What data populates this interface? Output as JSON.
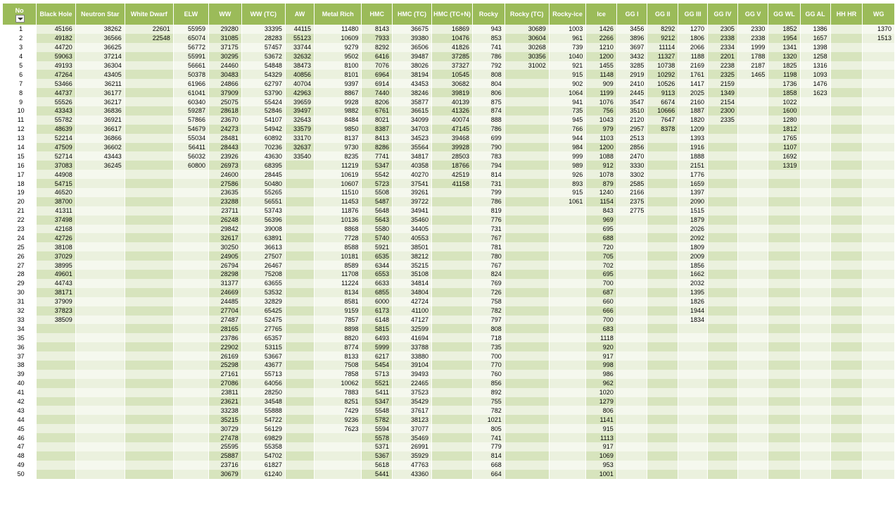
{
  "columns": [
    "Black Hole",
    "Neutron Star",
    "White Dwarf",
    "ELW",
    "WW",
    "WW (TC)",
    "AW",
    "Metal Rich",
    "HMC",
    "HMC (TC)",
    "HMC (TC+N)",
    "Rocky",
    "Rocky (TC)",
    "Rocky-ice",
    "Ice",
    "GG I",
    "GG II",
    "GG III",
    "GG IV",
    "GG V",
    "GG WL",
    "GG AL",
    "HH HR",
    "WG"
  ],
  "no_header": "No",
  "data": {
    "Black Hole": [
      "45166",
      "49182",
      "44720",
      "59063",
      "49193",
      "47264",
      "53466",
      "44737",
      "55526",
      "43343",
      "55782",
      "48639",
      "52214",
      "47509",
      "52714",
      "37083",
      "44908",
      "54715",
      "46520",
      "38700",
      "41311",
      "37498",
      "42168",
      "42726",
      "38108",
      "37029",
      "38995",
      "49601",
      "44743",
      "38171",
      "37909",
      "37823",
      "38509"
    ],
    "Neutron Star": [
      "38262",
      "36566",
      "36625",
      "37214",
      "36304",
      "43405",
      "36211",
      "36177",
      "36217",
      "36836",
      "36921",
      "36617",
      "36866",
      "36602",
      "43443",
      "36245"
    ],
    "White Dwarf": [
      "22601",
      "22548"
    ],
    "ELW": [
      "55959",
      "65074",
      "56772",
      "55991",
      "56661",
      "50378",
      "61966",
      "61041",
      "60340",
      "59287",
      "57866",
      "54679",
      "55034",
      "56411",
      "56032",
      "60800"
    ],
    "WW": [
      "29280",
      "31085",
      "37175",
      "30295",
      "24460",
      "30483",
      "24866",
      "37909",
      "25075",
      "28618",
      "23670",
      "24273",
      "28481",
      "28443",
      "23926",
      "26973",
      "24600",
      "27586",
      "23635",
      "23288",
      "23711",
      "26248",
      "29842",
      "32617",
      "30250",
      "24905",
      "26794",
      "28298",
      "31377",
      "24669",
      "24485",
      "27704",
      "27487",
      "28165",
      "23786",
      "22902",
      "26169",
      "25298",
      "27161",
      "27086",
      "23811",
      "23621",
      "33238",
      "35215",
      "30729",
      "27478",
      "25595",
      "25887",
      "23716",
      "30679"
    ],
    "WW (TC)": [
      "33395",
      "28283",
      "57457",
      "53672",
      "54848",
      "54329",
      "62797",
      "53790",
      "55424",
      "52846",
      "54107",
      "54942",
      "60892",
      "70236",
      "43630",
      "68395",
      "28445",
      "50480",
      "55265",
      "56551",
      "53743",
      "56396",
      "39008",
      "63891",
      "36613",
      "27507",
      "26467",
      "75208",
      "63655",
      "53532",
      "32829",
      "65425",
      "52475",
      "27765",
      "65357",
      "53115",
      "53667",
      "43677",
      "55713",
      "64056",
      "28250",
      "34548",
      "55888",
      "54722",
      "56129",
      "69829",
      "55358",
      "54702",
      "61827",
      "61240"
    ],
    "AW": [
      "44115",
      "55123",
      "33744",
      "32632",
      "38473",
      "40856",
      "40704",
      "42963",
      "39659",
      "39497",
      "32643",
      "33579",
      "33170",
      "32637",
      "33540"
    ],
    "Metal Rich": [
      "11480",
      "10609",
      "9279",
      "9502",
      "8100",
      "8101",
      "9397",
      "8867",
      "9928",
      "9882",
      "8484",
      "9850",
      "8137",
      "9730",
      "8235",
      "11219",
      "10619",
      "10607",
      "11510",
      "11453",
      "11876",
      "10136",
      "8868",
      "7728",
      "8588",
      "10181",
      "8589",
      "11708",
      "11224",
      "8134",
      "8581",
      "9159",
      "7857",
      "8898",
      "8820",
      "8774",
      "8133",
      "7508",
      "7858",
      "10062",
      "7883",
      "8251",
      "7429",
      "9236",
      "7623"
    ],
    "HMC": [
      "8143",
      "7933",
      "8292",
      "6416",
      "7076",
      "6964",
      "6914",
      "7440",
      "8206",
      "6761",
      "8021",
      "8387",
      "8413",
      "8286",
      "7741",
      "5347",
      "5542",
      "5723",
      "5508",
      "5487",
      "5648",
      "5643",
      "5580",
      "5740",
      "5921",
      "6535",
      "6344",
      "6553",
      "6633",
      "6855",
      "6000",
      "6173",
      "6148",
      "5815",
      "6493",
      "5999",
      "6217",
      "5454",
      "5713",
      "5521",
      "5411",
      "5347",
      "5548",
      "5782",
      "5594",
      "5578",
      "5371",
      "5367",
      "5618",
      "5441"
    ],
    "HMC (TC)": [
      "36675",
      "39380",
      "36506",
      "39487",
      "38026",
      "38194",
      "43453",
      "38246",
      "35877",
      "36615",
      "34099",
      "34703",
      "34523",
      "35564",
      "34817",
      "40358",
      "40270",
      "37541",
      "39261",
      "39722",
      "34941",
      "35460",
      "34405",
      "40553",
      "38501",
      "38212",
      "35215",
      "35108",
      "34814",
      "34804",
      "42724",
      "41100",
      "47127",
      "32599",
      "41694",
      "33788",
      "33880",
      "39104",
      "39493",
      "22465",
      "37523",
      "35429",
      "37617",
      "38123",
      "37077",
      "35469",
      "26991",
      "35929",
      "47763",
      "43360"
    ],
    "HMC (TC+N)": [
      "16869",
      "10476",
      "41826",
      "37285",
      "37327",
      "10545",
      "30682",
      "39819",
      "40139",
      "41326",
      "40074",
      "47145",
      "39468",
      "39928",
      "28503",
      "18766",
      "42519",
      "41158"
    ],
    "Rocky": [
      "943",
      "853",
      "741",
      "786",
      "792",
      "808",
      "804",
      "806",
      "875",
      "874",
      "888",
      "786",
      "699",
      "790",
      "783",
      "794",
      "814",
      "731",
      "799",
      "786",
      "819",
      "776",
      "731",
      "767",
      "781",
      "780",
      "767",
      "824",
      "769",
      "726",
      "758",
      "782",
      "797",
      "808",
      "718",
      "735",
      "700",
      "770",
      "760",
      "856",
      "892",
      "755",
      "782",
      "1021",
      "805",
      "741",
      "779",
      "814",
      "668",
      "664"
    ],
    "Rocky (TC)": [
      "30689",
      "30604",
      "30268",
      "30356",
      "31002"
    ],
    "Rocky-ice": [
      "1003",
      "961",
      "739",
      "1040",
      "921",
      "915",
      "902",
      "1064",
      "941",
      "735",
      "945",
      "766",
      "944",
      "984",
      "999",
      "989",
      "926",
      "893",
      "915",
      "1061"
    ],
    "Ice": [
      "1426",
      "2266",
      "1210",
      "1200",
      "1455",
      "1148",
      "909",
      "1199",
      "1076",
      "756",
      "1043",
      "979",
      "1103",
      "1200",
      "1088",
      "912",
      "1078",
      "879",
      "1240",
      "1154",
      "843",
      "969",
      "695",
      "688",
      "720",
      "705",
      "702",
      "695",
      "700",
      "687",
      "660",
      "666",
      "700",
      "683",
      "1118",
      "920",
      "917",
      "998",
      "986",
      "962",
      "1020",
      "1279",
      "806",
      "1141",
      "915",
      "1113",
      "917",
      "1069",
      "953",
      "1001"
    ],
    "GG I": [
      "3456",
      "3896",
      "3697",
      "3432",
      "3285",
      "2919",
      "2410",
      "2445",
      "3547",
      "3510",
      "2120",
      "2957",
      "2513",
      "2856",
      "2470",
      "3330",
      "3302",
      "2585",
      "2166",
      "2375",
      "2775"
    ],
    "GG II": [
      "8292",
      "9212",
      "11114",
      "11327",
      "10738",
      "10292",
      "10526",
      "9113",
      "6674",
      "10666",
      "7647",
      "8378"
    ],
    "GG III": [
      "1270",
      "1806",
      "2066",
      "1188",
      "2169",
      "1761",
      "1417",
      "2025",
      "2160",
      "1887",
      "1820",
      "1209",
      "1393",
      "1916",
      "1888",
      "2151",
      "1776",
      "1659",
      "1397",
      "2090",
      "1515",
      "1879",
      "2026",
      "2092",
      "1809",
      "2009",
      "1856",
      "1662",
      "2032",
      "1395",
      "1826",
      "1944",
      "1834"
    ],
    "GG IV": [
      "2305",
      "2338",
      "2334",
      "2201",
      "2238",
      "2325",
      "2159",
      "1349",
      "2154",
      "2300",
      "2335"
    ],
    "GG V": [
      "2330",
      "2338",
      "1999",
      "1788",
      "2187",
      "1465"
    ],
    "GG WL": [
      "1852",
      "1954",
      "1341",
      "1320",
      "1825",
      "1198",
      "1736",
      "1858",
      "1022",
      "1600",
      "1280",
      "1812",
      "1765",
      "1107",
      "1692",
      "1319"
    ],
    "GG AL": [
      "1386",
      "1657",
      "1398",
      "1258",
      "1316",
      "1093",
      "1476",
      "1623"
    ],
    "HH HR": [],
    "WG": [
      "1370",
      "1513"
    ]
  }
}
